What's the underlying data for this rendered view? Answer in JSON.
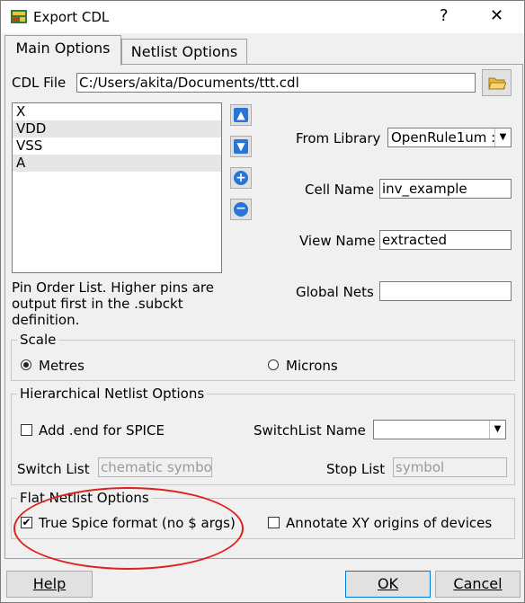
{
  "window": {
    "title": "Export CDL",
    "help_glyph": "?",
    "close_glyph": "✕"
  },
  "tabs": [
    {
      "label": "Main Options"
    },
    {
      "label": "Netlist Options"
    }
  ],
  "cdl_file": {
    "label": "CDL File",
    "value": "C:/Users/akita/Documents/ttt.cdl"
  },
  "pin_list": {
    "items": [
      "X",
      "VDD",
      "VSS",
      "A"
    ],
    "help_text": [
      "Pin Order List. Higher pins are",
      "output first in the .subckt",
      "definition."
    ]
  },
  "from_library": {
    "label": "From Library",
    "value": "OpenRule1um :"
  },
  "cell_name": {
    "label": "Cell Name",
    "value": "inv_example"
  },
  "view_name": {
    "label": "View Name",
    "value": "extracted"
  },
  "global_nets": {
    "label": "Global Nets",
    "value": ""
  },
  "scale": {
    "title": "Scale",
    "options": [
      "Metres",
      "Microns"
    ],
    "selected": "Metres"
  },
  "hier": {
    "title": "Hierarchical Netlist Options",
    "add_end_label": "Add .end for SPICE",
    "add_end_checked": false,
    "switchlist_name_label": "SwitchList Name",
    "switchlist_name_value": "",
    "switch_list_label": "Switch List",
    "switch_list_value": "chematic symbol",
    "stop_list_label": "Stop List",
    "stop_list_value": "symbol"
  },
  "flat": {
    "title": "Flat Netlist Options",
    "true_spice_label": "True Spice format (no $ args)",
    "true_spice_checked": true,
    "annotate_label": "Annotate XY origins of devices",
    "annotate_checked": false
  },
  "buttons": {
    "help": "Help",
    "ok": "OK",
    "cancel": "Cancel"
  },
  "colors": {
    "annotation": "#e0201c",
    "move_button": "#2a74d6"
  }
}
